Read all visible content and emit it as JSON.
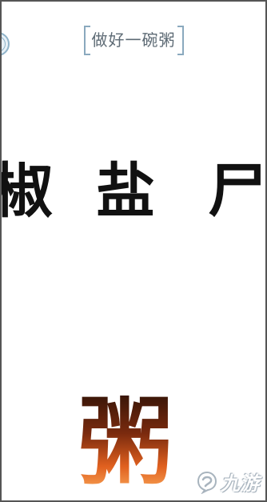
{
  "header": {
    "title": "做好一碗粥",
    "back_icon": "round-back-icon"
  },
  "puzzle": {
    "characters": [
      "椒",
      "盐",
      "尸"
    ]
  },
  "answer": {
    "character": "粥"
  },
  "watermark": {
    "text": "九游",
    "icon": "jiuyou-logo-icon"
  }
}
